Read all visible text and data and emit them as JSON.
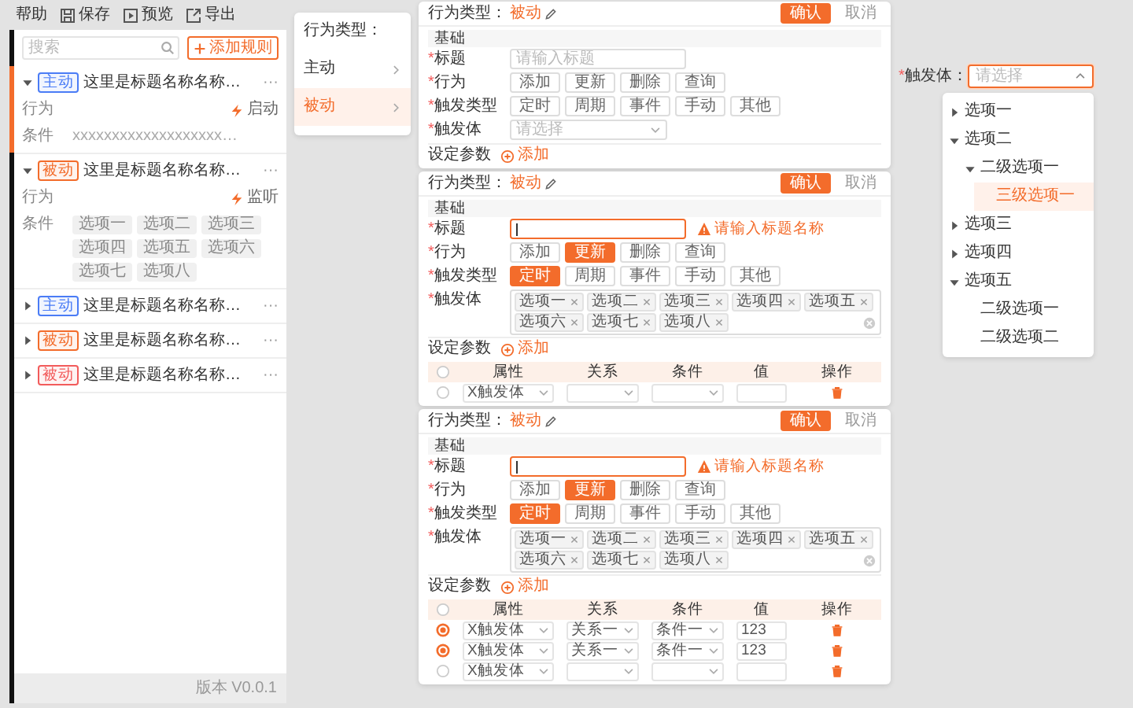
{
  "toolbar": [
    {
      "label": "帮助"
    },
    {
      "label": "保存"
    },
    {
      "label": "预览"
    },
    {
      "label": "导出"
    }
  ],
  "rule_list": {
    "search": {
      "placeholder": "搜索"
    },
    "add_button": "添加规则",
    "items": [
      {
        "tag": "主动",
        "color": "#4a7cf6",
        "title": "这里是标题名称名称…",
        "more": "···",
        "expanded": true,
        "selected": true,
        "details": [
          {
            "kind": "action",
            "label": "行为",
            "value": "启动"
          },
          {
            "kind": "text",
            "label": "条件",
            "value": "xxxxxxxxxxxxxxxxxxx…"
          }
        ]
      },
      {
        "tag": "被动",
        "color": "#f36c2b",
        "title": "这里是标题名称名称…",
        "more": "···",
        "expanded": true,
        "selected": false,
        "details": [
          {
            "kind": "action",
            "label": "行为",
            "value": "监听"
          },
          {
            "kind": "chips",
            "label": "条件",
            "chips": [
              "选项一",
              "选项二",
              "选项三",
              "选项四",
              "选项五",
              "选项六",
              "选项七",
              "选项八"
            ]
          }
        ]
      },
      {
        "tag": "主动",
        "color": "#4a7cf6",
        "title": "这里是标题名称名称…",
        "more": "···",
        "expanded": false,
        "selected": false
      },
      {
        "tag": "被动",
        "color": "#f36c2b",
        "title": "这里是标题名称名称…",
        "more": "···",
        "expanded": false,
        "selected": false
      },
      {
        "tag": "被动",
        "color": "#f25b5b",
        "title": "这里是标题名称名称…",
        "more": "···",
        "expanded": false,
        "selected": false
      }
    ],
    "version": "版本 V0.0.1"
  },
  "type_menu": {
    "title": "行为类型：",
    "items": [
      {
        "label": "主动",
        "selected": false
      },
      {
        "label": "被动",
        "selected": true
      }
    ]
  },
  "forms": [
    {
      "title_label": "行为类型：",
      "title_value": "被动",
      "confirm": "确认",
      "cancel": "取消",
      "section": "基础",
      "fields": [
        {
          "kind": "input",
          "star": "*",
          "label": "标题",
          "placeholder": "请输入标题",
          "focused": false
        },
        {
          "kind": "choice",
          "star": "*",
          "label": "行为",
          "options": [
            {
              "label": "添加",
              "selected": false
            },
            {
              "label": "更新",
              "selected": false
            },
            {
              "label": "删除",
              "selected": false
            },
            {
              "label": "查询",
              "selected": false
            }
          ]
        },
        {
          "kind": "choice",
          "star": "*",
          "label": "触发类型",
          "options": [
            {
              "label": "定时",
              "selected": false
            },
            {
              "label": "周期",
              "selected": false
            },
            {
              "label": "事件",
              "selected": false
            },
            {
              "label": "手动",
              "selected": false
            },
            {
              "label": "其他",
              "selected": false
            }
          ]
        },
        {
          "kind": "select",
          "star": "*",
          "label": "触发体",
          "placeholder": "请选择"
        }
      ],
      "params": {
        "label": "设定参数",
        "add": "添加"
      }
    },
    {
      "title_label": "行为类型：",
      "title_value": "被动",
      "confirm": "确认",
      "cancel": "取消",
      "section": "基础",
      "fields": [
        {
          "kind": "input",
          "star": "*",
          "label": "标题",
          "focused": true,
          "error": "请输入标题名称"
        },
        {
          "kind": "choice",
          "star": "*",
          "label": "行为",
          "options": [
            {
              "label": "添加",
              "selected": false
            },
            {
              "label": "更新",
              "selected": true
            },
            {
              "label": "删除",
              "selected": false
            },
            {
              "label": "查询",
              "selected": false
            }
          ]
        },
        {
          "kind": "choice",
          "star": "*",
          "label": "触发类型",
          "options": [
            {
              "label": "定时",
              "selected": true
            },
            {
              "label": "周期",
              "selected": false
            },
            {
              "label": "事件",
              "selected": false
            },
            {
              "label": "手动",
              "selected": false
            },
            {
              "label": "其他",
              "selected": false
            }
          ]
        },
        {
          "kind": "tags",
          "star": "*",
          "label": "触发体",
          "tags": [
            "选项一",
            "选项二",
            "选项三",
            "选项四",
            "选项五",
            "选项六",
            "选项七",
            "选项八"
          ]
        }
      ],
      "params": {
        "label": "设定参数",
        "add": "添加",
        "table": {
          "all_selected": false,
          "columns": [
            "属性",
            "关系",
            "条件",
            "值",
            "操作"
          ],
          "rows": [
            {
              "selected": false,
              "attribute": "X触发体"
            }
          ]
        }
      }
    },
    {
      "title_label": "行为类型：",
      "title_value": "被动",
      "confirm": "确认",
      "cancel": "取消",
      "section": "基础",
      "fields": [
        {
          "kind": "input",
          "star": "*",
          "label": "标题",
          "focused": true,
          "error": "请输入标题名称"
        },
        {
          "kind": "choice",
          "star": "*",
          "label": "行为",
          "options": [
            {
              "label": "添加",
              "selected": false
            },
            {
              "label": "更新",
              "selected": true
            },
            {
              "label": "删除",
              "selected": false
            },
            {
              "label": "查询",
              "selected": false
            }
          ]
        },
        {
          "kind": "choice",
          "star": "*",
          "label": "触发类型",
          "options": [
            {
              "label": "定时",
              "selected": true
            },
            {
              "label": "周期",
              "selected": false
            },
            {
              "label": "事件",
              "selected": false
            },
            {
              "label": "手动",
              "selected": false
            },
            {
              "label": "其他",
              "selected": false
            }
          ]
        },
        {
          "kind": "tags",
          "star": "*",
          "label": "触发体",
          "tags": [
            "选项一",
            "选项二",
            "选项三",
            "选项四",
            "选项五",
            "选项六",
            "选项七",
            "选项八"
          ]
        }
      ],
      "params": {
        "label": "设定参数",
        "add": "添加",
        "table": {
          "all_selected": false,
          "columns": [
            "属性",
            "关系",
            "条件",
            "值",
            "操作"
          ],
          "rows": [
            {
              "selected": true,
              "attribute": "X触发体",
              "relation": "关系一",
              "condition": "条件一",
              "value": "123"
            },
            {
              "selected": true,
              "attribute": "X触发体",
              "relation": "关系一",
              "condition": "条件一",
              "value": "123"
            },
            {
              "selected": false,
              "attribute": "X触发体"
            }
          ]
        }
      }
    }
  ],
  "tree_select": {
    "star": "*",
    "label": "触发体：",
    "placeholder": "请选择",
    "open": true,
    "options": [
      {
        "label": "选项一",
        "expanded": false,
        "selected": false
      },
      {
        "label": "选项二",
        "expanded": true,
        "selected": false,
        "children": [
          {
            "label": "二级选项一",
            "expanded": true,
            "selected": false,
            "children": [
              {
                "label": "三级选项一",
                "selected": true
              }
            ]
          }
        ]
      },
      {
        "label": "选项三",
        "expanded": false,
        "selected": false
      },
      {
        "label": "选项四",
        "expanded": false,
        "selected": false
      },
      {
        "label": "选项五",
        "expanded": true,
        "selected": false,
        "children": [
          {
            "label": "二级选项一",
            "selected": false
          },
          {
            "label": "二级选项二",
            "selected": false
          }
        ]
      }
    ]
  }
}
